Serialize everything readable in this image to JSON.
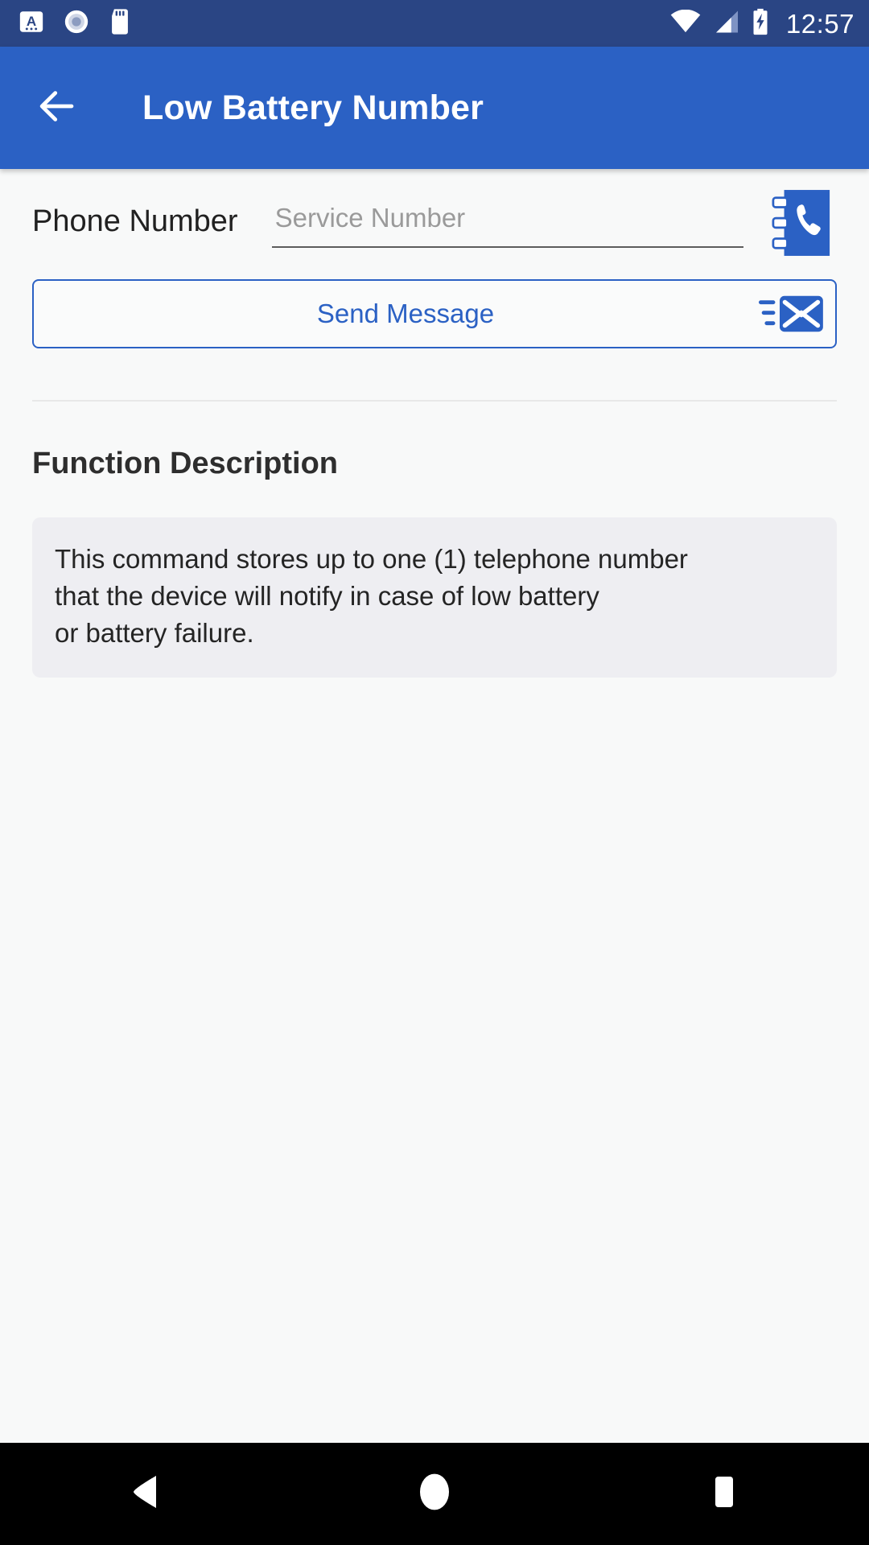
{
  "status_bar": {
    "icons": [
      "app-notification-icon",
      "record-circle-icon",
      "sd-card-icon"
    ],
    "right_icons": [
      "wifi-icon",
      "cellular-signal-icon",
      "battery-charging-icon"
    ],
    "clock": "12:57",
    "background_color": "#2a4584"
  },
  "app_bar": {
    "back_icon": "arrow-left-icon",
    "title": "Low Battery Number",
    "background_color": "#2b61c4",
    "text_color": "#ffffff"
  },
  "form": {
    "phone_label": "Phone Number",
    "phone_value": "",
    "phone_placeholder": "Service Number",
    "contact_picker_icon": "contact-book-icon",
    "send_button_label": "Send Message",
    "send_button_icon": "send-message-envelope-icon",
    "accent_color": "#2b61c4"
  },
  "description": {
    "heading": "Function Description",
    "lines": [
      "This command stores up to one (1) telephone number",
      "that the device will notify in case of low battery",
      "or battery failure."
    ],
    "card_background": "#eeeef2"
  },
  "nav_bar": {
    "back_label": "back-triangle-icon",
    "home_label": "home-circle-icon",
    "recents_label": "recents-square-icon",
    "background_color": "#000000"
  }
}
